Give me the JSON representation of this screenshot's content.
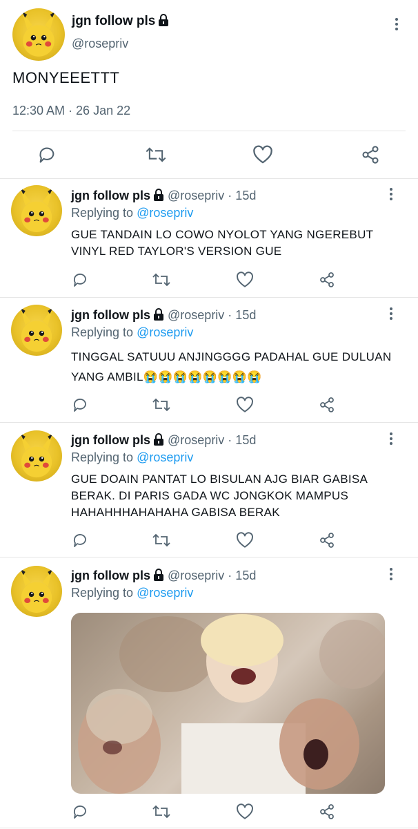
{
  "main_tweet": {
    "display_name": "jgn follow pls",
    "handle": "@rosepriv",
    "text": "MONYEEETTT",
    "timestamp": "12:30 AM · 26 Jan 22"
  },
  "replies": [
    {
      "display_name": "jgn follow pls",
      "handle_time": "@rosepriv · 15d",
      "replying_prefix": "Replying to",
      "replying_to": "@rosepriv",
      "text": "GUE TANDAIN LO COWO NYOLOT YANG NGEREBUT VINYL RED TAYLOR'S VERSION GUE"
    },
    {
      "display_name": "jgn follow pls",
      "handle_time": "@rosepriv · 15d",
      "replying_prefix": "Replying to",
      "replying_to": "@rosepriv",
      "text": "TINGGAL SATUUU ANJINGGGG PADAHAL GUE DULUAN YANG AMBIL😭😭😭😭😭😭😭😭"
    },
    {
      "display_name": "jgn follow pls",
      "handle_time": "@rosepriv · 15d",
      "replying_prefix": "Replying to",
      "replying_to": "@rosepriv",
      "text": "GUE DOAIN PANTAT LO BISULAN AJG BIAR GABISA BERAK. DI PARIS GADA WC JONGKOK MAMPUS HAHAHHHAHAHAHA GABISA BERAK"
    },
    {
      "display_name": "jgn follow pls",
      "handle_time": "@rosepriv · 15d",
      "replying_prefix": "Replying to",
      "replying_to": "@rosepriv"
    }
  ],
  "icons": {
    "reply": "reply-icon",
    "retweet": "retweet-icon",
    "like": "heart-icon",
    "share": "share-icon",
    "more": "more-options-icon",
    "lock": "lock-icon"
  },
  "colors": {
    "link": "#1d9bf0",
    "secondary_text": "#536471",
    "avatar_yellow": "#f2cf3a"
  }
}
